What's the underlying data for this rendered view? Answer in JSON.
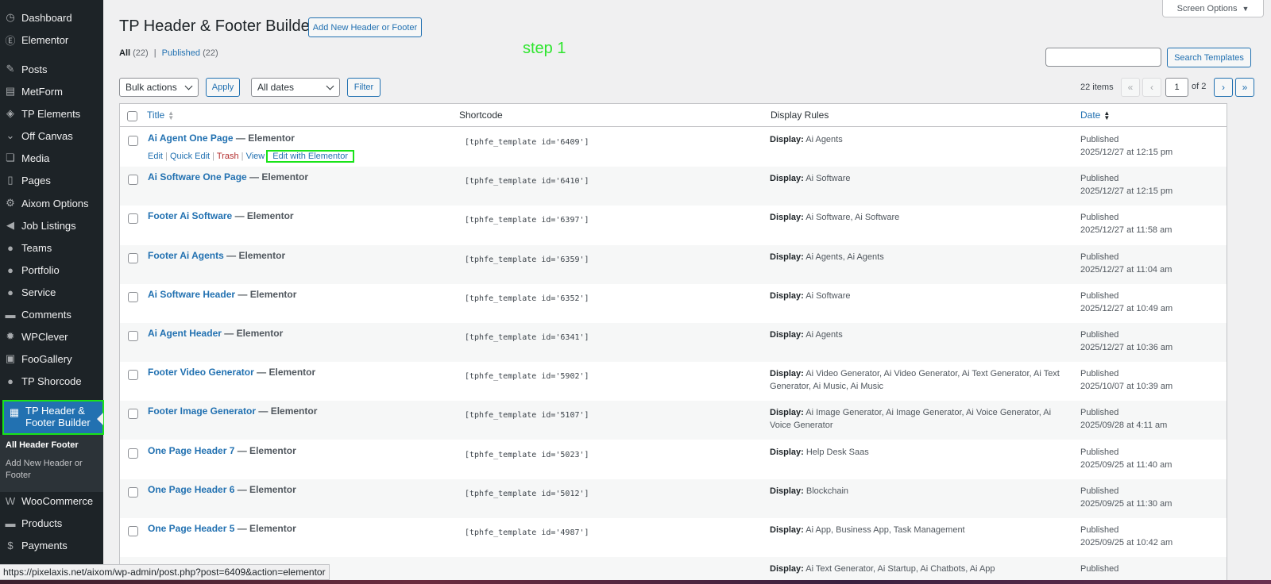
{
  "sidebar": {
    "items": [
      {
        "label": "Dashboard",
        "icon": "dashboard-icon",
        "glyph": "◷"
      },
      {
        "label": "Elementor",
        "icon": "elementor-icon",
        "glyph": "Ⓔ"
      },
      {
        "label": "Posts",
        "icon": "pin-icon",
        "glyph": "✎"
      },
      {
        "label": "MetForm",
        "icon": "form-icon",
        "glyph": "▤"
      },
      {
        "label": "TP Elements",
        "icon": "tp-icon",
        "glyph": "◈"
      },
      {
        "label": "Off Canvas",
        "icon": "chevron-down-icon",
        "glyph": "⌄"
      },
      {
        "label": "Media",
        "icon": "media-icon",
        "glyph": "❏"
      },
      {
        "label": "Pages",
        "icon": "pages-icon",
        "glyph": "▯"
      },
      {
        "label": "Aixom Options",
        "icon": "gear-icon",
        "glyph": "⚙"
      },
      {
        "label": "Job Listings",
        "icon": "megaphone-icon",
        "glyph": "◀"
      },
      {
        "label": "Teams",
        "icon": "teams-icon",
        "glyph": "●"
      },
      {
        "label": "Portfolio",
        "icon": "portfolio-icon",
        "glyph": "●"
      },
      {
        "label": "Service",
        "icon": "service-icon",
        "glyph": "●"
      },
      {
        "label": "Comments",
        "icon": "comment-icon",
        "glyph": "▬"
      },
      {
        "label": "WPClever",
        "icon": "wpclever-icon",
        "glyph": "✹"
      },
      {
        "label": "FooGallery",
        "icon": "gallery-icon",
        "glyph": "▣"
      },
      {
        "label": "TP Shorcode",
        "icon": "shortcode-icon",
        "glyph": "●"
      }
    ],
    "current": {
      "label": "TP Header & Footer Builder",
      "icon": "builder-icon",
      "glyph": "▦"
    },
    "submenu": [
      "All Header Footer",
      "Add New Header or Footer"
    ],
    "bottom_items": [
      {
        "label": "WooCommerce",
        "icon": "woocommerce-icon",
        "glyph": "W"
      },
      {
        "label": "Products",
        "icon": "products-icon",
        "glyph": "▬"
      },
      {
        "label": "Payments",
        "icon": "payments-icon",
        "glyph": "$"
      }
    ]
  },
  "header": {
    "title": "TP Header & Footer Builder",
    "add_new": "Add New Header or Footer",
    "screen_options": "Screen Options",
    "step_note": "step 1"
  },
  "filters": {
    "all_label": "All",
    "all_count": "(22)",
    "published_label": "Published",
    "published_count": "(22)",
    "separator": "|",
    "bulk_actions": "Bulk actions",
    "apply": "Apply",
    "all_dates": "All dates",
    "filter": "Filter",
    "search_button": "Search Templates"
  },
  "pagination": {
    "items": "22 items",
    "first": "«",
    "prev": "‹",
    "current": "1",
    "of": "of 2",
    "next": "›",
    "last": "»"
  },
  "table": {
    "columns": {
      "title": "Title",
      "shortcode": "Shortcode",
      "display": "Display Rules",
      "date": "Date"
    },
    "display_prefix": "Display:",
    "row_actions": {
      "edit": "Edit",
      "quick_edit": "Quick Edit",
      "trash": "Trash",
      "view": "View",
      "edit_elementor": "Edit with Elementor"
    },
    "rows": [
      {
        "title": "Ai Agent One Page",
        "suffix": " — Elementor",
        "shortcode": "[tphfe_template id='6409']",
        "display": "Ai Agents",
        "status": "Published",
        "date": "2025/12/27 at 12:15 pm"
      },
      {
        "title": "Ai Software One Page",
        "suffix": " — Elementor",
        "shortcode": "[tphfe_template id='6410']",
        "display": "Ai Software",
        "status": "Published",
        "date": "2025/12/27 at 12:15 pm"
      },
      {
        "title": "Footer Ai Software",
        "suffix": " — Elementor",
        "shortcode": "[tphfe_template id='6397']",
        "display": "Ai Software, Ai Software",
        "status": "Published",
        "date": "2025/12/27 at 11:58 am"
      },
      {
        "title": "Footer Ai Agents",
        "suffix": " — Elementor",
        "shortcode": "[tphfe_template id='6359']",
        "display": "Ai Agents, Ai Agents",
        "status": "Published",
        "date": "2025/12/27 at 11:04 am"
      },
      {
        "title": "Ai Software Header",
        "suffix": " — Elementor",
        "shortcode": "[tphfe_template id='6352']",
        "display": "Ai Software",
        "status": "Published",
        "date": "2025/12/27 at 10:49 am"
      },
      {
        "title": "Ai Agent Header",
        "suffix": " — Elementor",
        "shortcode": "[tphfe_template id='6341']",
        "display": "Ai Agents",
        "status": "Published",
        "date": "2025/12/27 at 10:36 am"
      },
      {
        "title": "Footer Video Generator",
        "suffix": " — Elementor",
        "shortcode": "[tphfe_template id='5902']",
        "display": "Ai Video Generator, Ai Video Generator, Ai Text Generator, Ai Text Generator, Ai Music, Ai Music",
        "status": "Published",
        "date": "2025/10/07 at 10:39 am"
      },
      {
        "title": "Footer Image Generator",
        "suffix": " — Elementor",
        "shortcode": "[tphfe_template id='5107']",
        "display": "Ai Image Generator, Ai Image Generator, Ai Voice Generator, Ai Voice Generator",
        "status": "Published",
        "date": "2025/09/28 at 4:11 am"
      },
      {
        "title": "One Page Header 7",
        "suffix": " — Elementor",
        "shortcode": "[tphfe_template id='5023']",
        "display": "Help Desk Saas",
        "status": "Published",
        "date": "2025/09/25 at 11:40 am"
      },
      {
        "title": "One Page Header 6",
        "suffix": " — Elementor",
        "shortcode": "[tphfe_template id='5012']",
        "display": "Blockchain",
        "status": "Published",
        "date": "2025/09/25 at 11:30 am"
      },
      {
        "title": "One Page Header 5",
        "suffix": " — Elementor",
        "shortcode": "[tphfe_template id='4987']",
        "display": "Ai App, Business App, Task Management",
        "status": "Published",
        "date": "2025/09/25 at 10:42 am"
      },
      {
        "title": "",
        "suffix": "",
        "shortcode": "",
        "display": "Ai Text Generator, Ai Startup, Ai Chatbots, Ai App",
        "status": "Published",
        "date": ""
      }
    ]
  },
  "statusbar": {
    "url": "https://pixelaxis.net/aixom/wp-admin/post.php?post=6409&action=elementor"
  }
}
